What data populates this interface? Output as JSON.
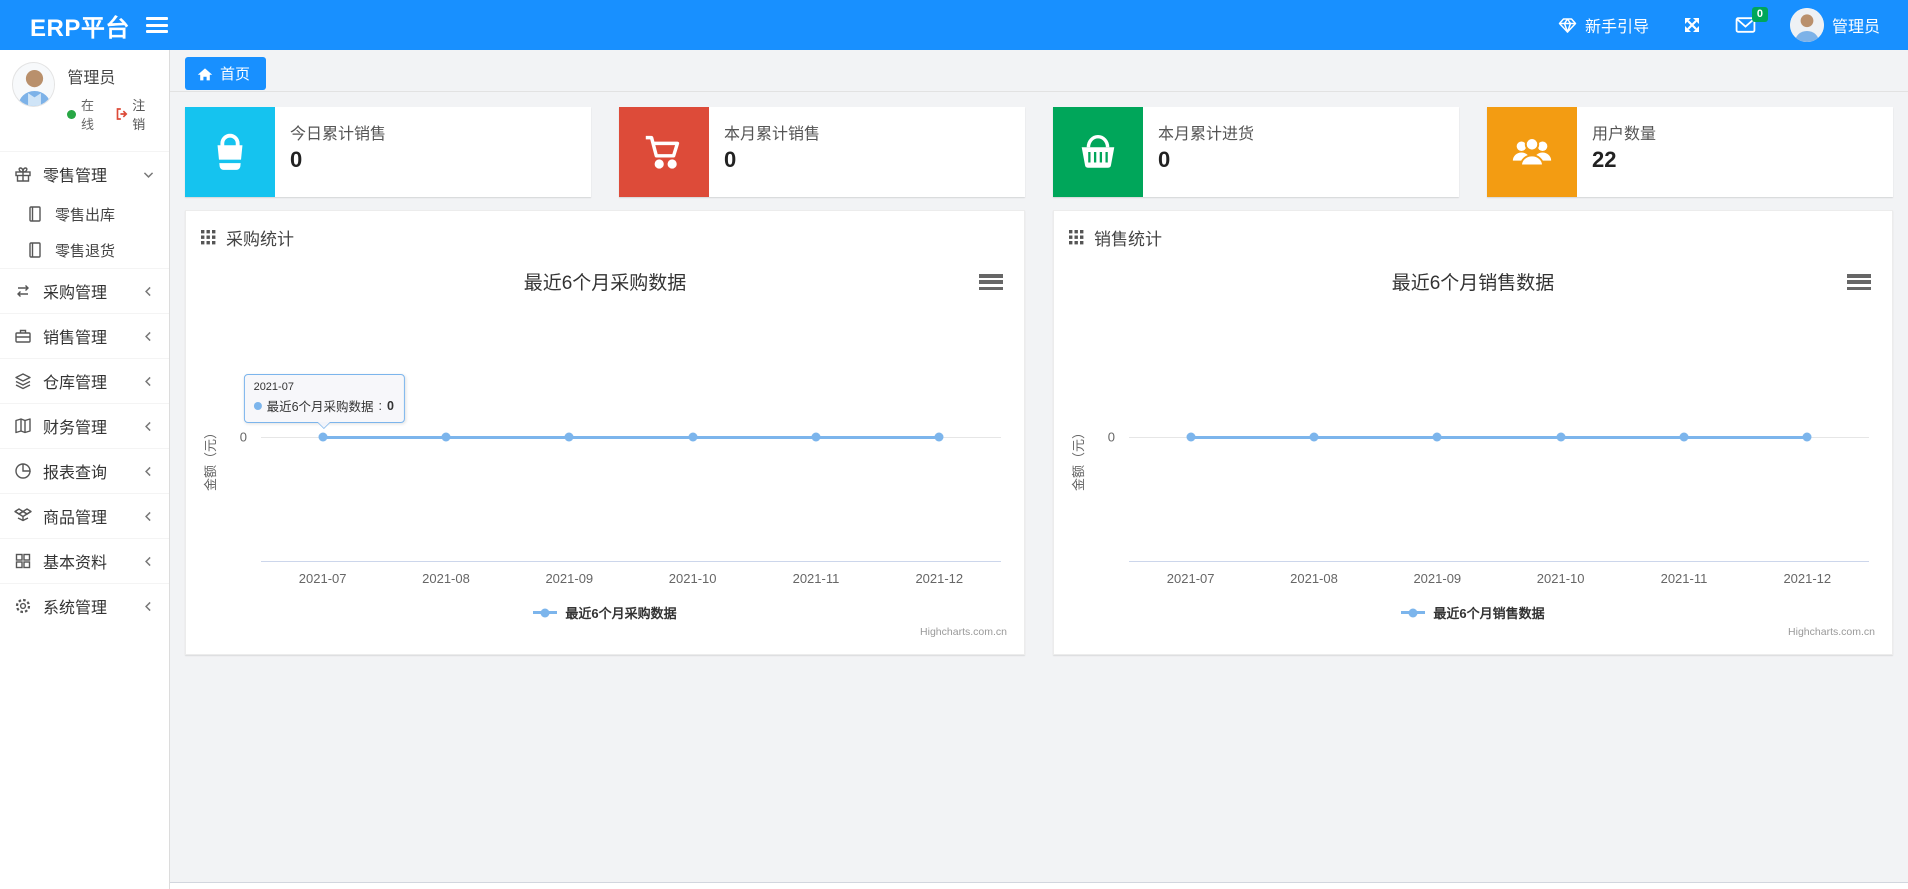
{
  "navbar": {
    "brand": "ERP平台",
    "guide_label": "新手引导",
    "message_badge": "0",
    "username": "管理员"
  },
  "sidebar": {
    "user": {
      "name": "管理员",
      "status_label": "在线",
      "logout_label": "注销"
    },
    "menu": [
      {
        "label": "零售管理",
        "icon": "gift-icon",
        "state": "expanded",
        "children": [
          {
            "label": "零售出库",
            "icon": "journal-icon"
          },
          {
            "label": "零售退货",
            "icon": "journal-icon"
          }
        ]
      },
      {
        "label": "采购管理",
        "icon": "exchange-icon",
        "state": "collapsed"
      },
      {
        "label": "销售管理",
        "icon": "briefcase-icon",
        "state": "collapsed"
      },
      {
        "label": "仓库管理",
        "icon": "layers-icon",
        "state": "collapsed"
      },
      {
        "label": "财务管理",
        "icon": "ledger-icon",
        "state": "collapsed"
      },
      {
        "label": "报表查询",
        "icon": "pie-chart-icon",
        "state": "collapsed"
      },
      {
        "label": "商品管理",
        "icon": "box-icon",
        "state": "collapsed"
      },
      {
        "label": "基本资料",
        "icon": "grid-icon",
        "state": "collapsed"
      },
      {
        "label": "系统管理",
        "icon": "gear-icon",
        "state": "collapsed"
      }
    ]
  },
  "tabs": {
    "home_label": "首页"
  },
  "stat_cards": [
    {
      "label": "今日累计销售",
      "value": "0",
      "color": "#15c3ef",
      "icon": "shopping-bag-icon"
    },
    {
      "label": "本月累计销售",
      "value": "0",
      "color": "#dd4b39",
      "icon": "shopping-cart-icon"
    },
    {
      "label": "本月累计进货",
      "value": "0",
      "color": "#00a65a",
      "icon": "shopping-basket-icon"
    },
    {
      "label": "用户数量",
      "value": "22",
      "color": "#f39c12",
      "icon": "users-icon"
    }
  ],
  "panels": [
    {
      "title": "采购统计"
    },
    {
      "title": "销售统计"
    }
  ],
  "chart_data": [
    {
      "type": "line",
      "title": "最近6个月采购数据",
      "categories": [
        "2021-07",
        "2021-08",
        "2021-09",
        "2021-10",
        "2021-11",
        "2021-12"
      ],
      "series": [
        {
          "name": "最近6个月采购数据",
          "values": [
            0,
            0,
            0,
            0,
            0,
            0
          ],
          "color": "#7cb5ec"
        }
      ],
      "ylabel": "金额（元）",
      "yticks": [
        0
      ],
      "grid": true,
      "legend_position": "bottom",
      "credits": "Highcharts.com.cn",
      "tooltip": {
        "visible": true,
        "header": "2021-07",
        "label": "最近6个月采购数据",
        "separator": ": ",
        "value": "0"
      }
    },
    {
      "type": "line",
      "title": "最近6个月销售数据",
      "categories": [
        "2021-07",
        "2021-08",
        "2021-09",
        "2021-10",
        "2021-11",
        "2021-12"
      ],
      "series": [
        {
          "name": "最近6个月销售数据",
          "values": [
            0,
            0,
            0,
            0,
            0,
            0
          ],
          "color": "#7cb5ec"
        }
      ],
      "ylabel": "金额（元）",
      "yticks": [
        0
      ],
      "grid": true,
      "legend_position": "bottom",
      "credits": "Highcharts.com.cn",
      "tooltip": {
        "visible": false
      }
    }
  ]
}
